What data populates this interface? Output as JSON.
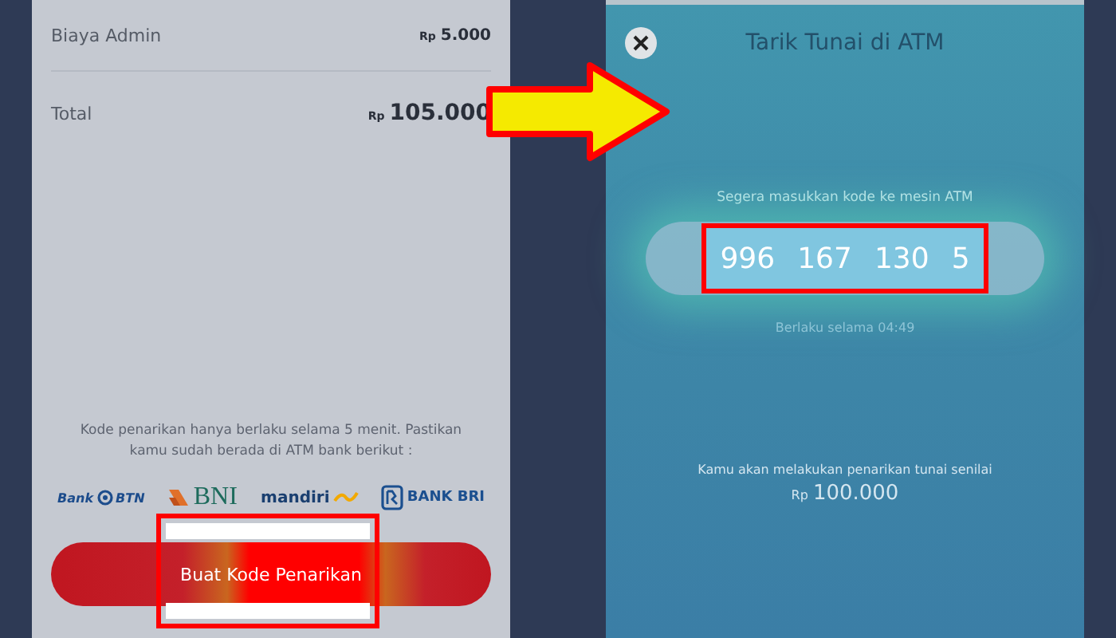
{
  "left_screen": {
    "rows": [
      {
        "label": "Biaya Admin",
        "currency": "Rp",
        "amount": "5.000",
        "kind": "fee"
      },
      {
        "label": "Total",
        "currency": "Rp",
        "amount": "105.000",
        "kind": "total"
      }
    ],
    "notice": "Kode penarikan hanya berlaku selama 5 menit. Pastikan kamu sudah berada di ATM bank berikut :",
    "banks": [
      {
        "kind": "btn",
        "words": [
          "Bank",
          "BTN"
        ]
      },
      {
        "kind": "bni",
        "words": [
          "BNI"
        ]
      },
      {
        "kind": "mandiri",
        "words": [
          "mandiri"
        ]
      },
      {
        "kind": "bri",
        "words": [
          "BANK BRI"
        ]
      }
    ],
    "button": "Buat Kode Penarikan"
  },
  "right_screen": {
    "title": "Tarik Tunai di ATM",
    "instruction": "Segera masukkan kode ke mesin ATM",
    "code_groups": [
      "996",
      "167",
      "130",
      "5"
    ],
    "validity": "Berlaku selama 04:49",
    "amount_note": "Kamu akan melakukan penarikan tunai senilai",
    "currency": "Rp",
    "amount": "100.000"
  }
}
